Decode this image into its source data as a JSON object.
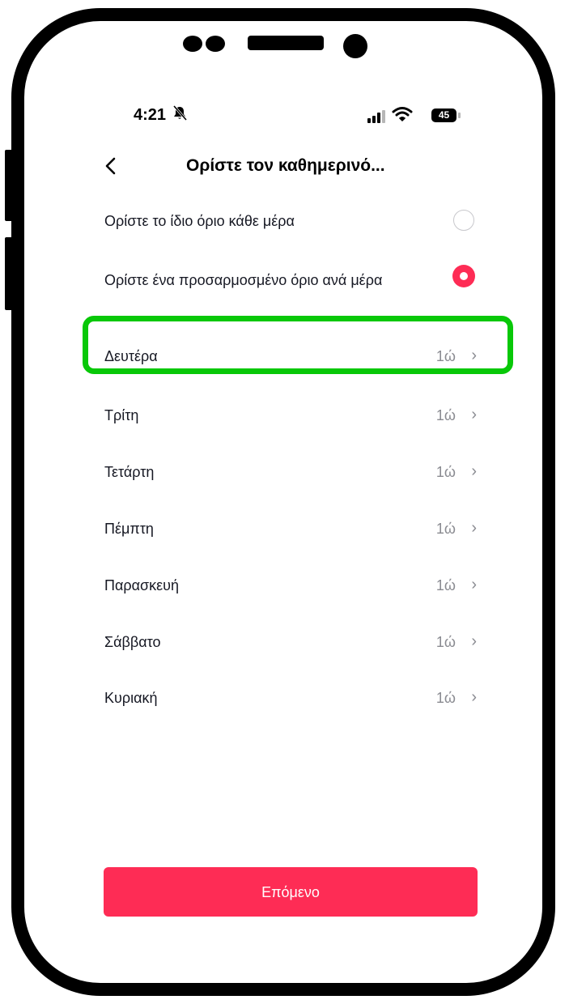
{
  "status_bar": {
    "time": "4:21",
    "battery": "45"
  },
  "header": {
    "title": "Ορίστε τον καθημερινό..."
  },
  "options": [
    {
      "label": "Ορίστε το ίδιο όριο κάθε μέρα",
      "selected": false
    },
    {
      "label": "Ορίστε ένα προσαρμοσμένο όριο ανά μέρα",
      "selected": true
    }
  ],
  "days": [
    {
      "label": "Δευτέρα",
      "value": "1ώ"
    },
    {
      "label": "Τρίτη",
      "value": "1ώ"
    },
    {
      "label": "Τετάρτη",
      "value": "1ώ"
    },
    {
      "label": "Πέμπτη",
      "value": "1ώ"
    },
    {
      "label": "Παρασκευή",
      "value": "1ώ"
    },
    {
      "label": "Σάββατο",
      "value": "1ώ"
    },
    {
      "label": "Κυριακή",
      "value": "1ώ"
    }
  ],
  "next_button": {
    "label": "Επόμενο"
  },
  "colors": {
    "accent": "#fe2c55",
    "highlight": "#08c808",
    "muted": "#8a8b91"
  },
  "icons": {
    "back": "chevron-left-icon",
    "row": "chevron-right-icon",
    "mute": "bell-slash-icon",
    "wifi": "wifi-icon",
    "signal": "signal-icon",
    "battery": "battery-icon"
  }
}
